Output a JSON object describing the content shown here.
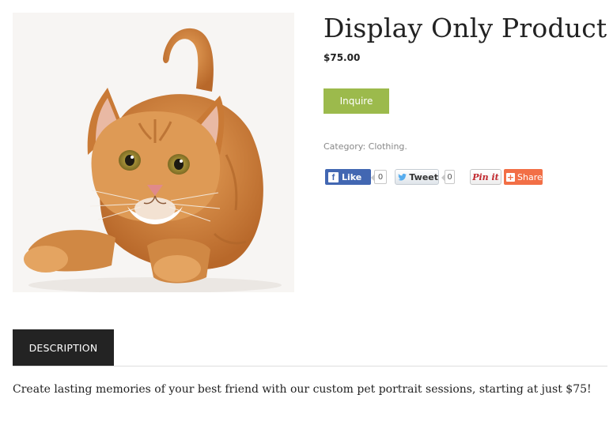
{
  "product": {
    "title": "Display Only Product",
    "price": "$75.00",
    "inquire_label": "Inquire",
    "category_label": "Category:",
    "category_value": "Clothing",
    "category_suffix": "."
  },
  "social": {
    "like_label": "Like",
    "like_count": "0",
    "tweet_label": "Tweet",
    "tweet_count": "0",
    "pin_label": "Pin it",
    "share_label": "Share"
  },
  "tabs": [
    {
      "label": "DESCRIPTION"
    }
  ],
  "description": "Create lasting memories of your best friend with our custom pet portrait sessions, starting at just $75!",
  "colors": {
    "inquire_button": "#9cba4c",
    "tab_background": "#232323",
    "facebook": "#4267b2",
    "share": "#f26f46"
  },
  "icons": {
    "facebook": "facebook-icon",
    "twitter": "twitter-bird-icon",
    "share_plus": "plus-icon"
  }
}
